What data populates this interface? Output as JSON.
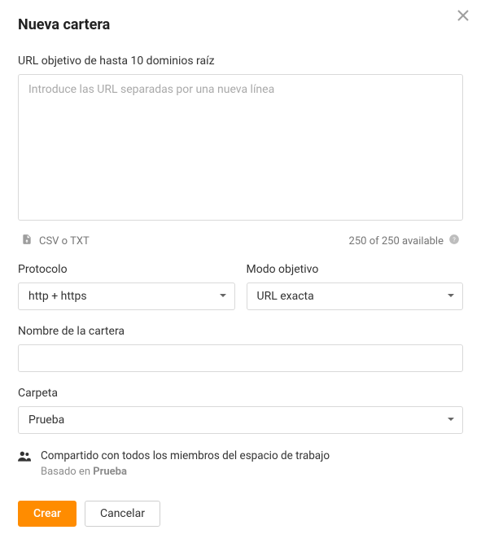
{
  "title": "Nueva cartera",
  "url_section": {
    "label": "URL objetivo de hasta 10 dominios raíz",
    "placeholder": "Introduce las URL separadas por una nueva línea"
  },
  "upload": {
    "label": "CSV o TXT"
  },
  "available": {
    "text": "250 of 250 available"
  },
  "protocol": {
    "label": "Protocolo",
    "value": "http + https"
  },
  "target_mode": {
    "label": "Modo objetivo",
    "value": "URL exacta"
  },
  "portfolio_name": {
    "label": "Nombre de la cartera",
    "value": ""
  },
  "folder": {
    "label": "Carpeta",
    "value": "Prueba"
  },
  "shared": {
    "line1": "Compartido con todos los miembros del espacio de trabajo",
    "based_prefix": "Basado en ",
    "based_value": "Prueba"
  },
  "actions": {
    "create": "Crear",
    "cancel": "Cancelar"
  }
}
